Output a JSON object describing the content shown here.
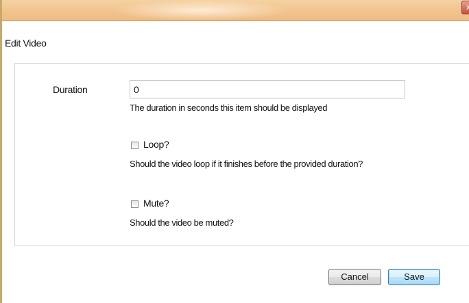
{
  "dialog": {
    "title": "Edit Video",
    "close_glyph": "x",
    "close_icon": "close-icon"
  },
  "duration": {
    "label": "Duration",
    "value": "0",
    "help": "The duration in seconds this item should be displayed"
  },
  "loop": {
    "label": "Loop?",
    "checked": false,
    "help": "Should the video loop if it finishes before the provided duration?"
  },
  "mute": {
    "label": "Mute?",
    "checked": false,
    "help": "Should the video be muted?"
  },
  "buttons": {
    "cancel_label": "Cancel",
    "save_label": "Save"
  },
  "colors": {
    "titlebar": "#f2c48f",
    "save_border": "#3c7fb1",
    "panel_border": "#d4d4d4"
  }
}
